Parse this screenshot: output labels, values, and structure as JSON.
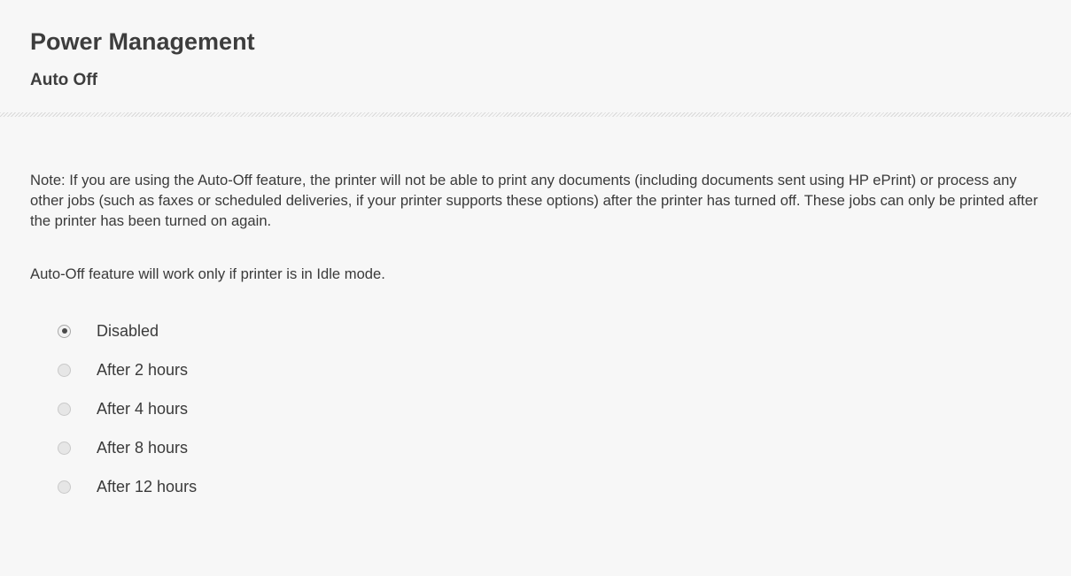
{
  "header": {
    "title": "Power Management",
    "subtitle": "Auto Off"
  },
  "content": {
    "note": "Note: If you are using the Auto-Off feature, the printer will not be able to print any documents (including documents sent using HP ePrint) or process any other jobs (such as faxes or scheduled deliveries, if your printer supports these options) after the printer has turned off. These jobs can only be printed after the printer has been turned on again.",
    "idle_note": "Auto-Off feature will work only if printer is in Idle mode."
  },
  "auto_off": {
    "selected": "Disabled",
    "options": [
      {
        "label": "Disabled"
      },
      {
        "label": "After 2 hours"
      },
      {
        "label": "After 4 hours"
      },
      {
        "label": "After 8 hours"
      },
      {
        "label": "After 12 hours"
      }
    ]
  }
}
